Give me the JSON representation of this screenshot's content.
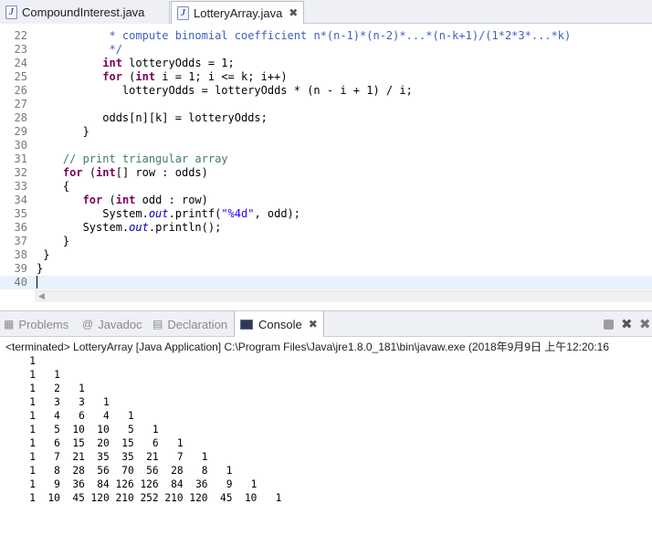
{
  "editor_tabs": [
    {
      "label": "CompoundInterest.java",
      "active": false
    },
    {
      "label": "LotteryArray.java",
      "active": true,
      "close": "✖"
    }
  ],
  "code_lines": [
    {
      "n": "22",
      "html": "           <span class=\"cm\">* compute binomial coefficient n*(n-1)*(n-2)*...*(n-k+1)/(1*2*3*...*k)</span>"
    },
    {
      "n": "23",
      "html": "           <span class=\"cm\">*/</span>"
    },
    {
      "n": "24",
      "html": "          <span class=\"kw\">int</span> lotteryOdds = 1;"
    },
    {
      "n": "25",
      "html": "          <span class=\"kw\">for</span> (<span class=\"kw\">int</span> i = 1; i &lt;= k; i++)"
    },
    {
      "n": "26",
      "html": "             lotteryOdds = lotteryOdds * (n - i + 1) / i;"
    },
    {
      "n": "27",
      "html": ""
    },
    {
      "n": "28",
      "html": "          odds[n][k] = lotteryOdds;"
    },
    {
      "n": "29",
      "html": "       }"
    },
    {
      "n": "30",
      "html": ""
    },
    {
      "n": "31",
      "html": "    <span class=\"lc\">// print triangular array</span>"
    },
    {
      "n": "32",
      "html": "    <span class=\"kw\">for</span> (<span class=\"kw\">int</span>[] row : odds)"
    },
    {
      "n": "33",
      "html": "    {"
    },
    {
      "n": "34",
      "html": "       <span class=\"kw\">for</span> (<span class=\"kw\">int</span> odd : row)"
    },
    {
      "n": "35",
      "html": "          System.<span class=\"fld\">out</span>.printf(<span class=\"str\">\"%4d\"</span>, odd);"
    },
    {
      "n": "36",
      "html": "       System.<span class=\"fld\">out</span>.println();"
    },
    {
      "n": "37",
      "html": "    }"
    },
    {
      "n": "38",
      "html": " }"
    },
    {
      "n": "39",
      "html": "}"
    },
    {
      "n": "40",
      "html": "",
      "current": true
    }
  ],
  "view_tabs": [
    {
      "label": "Problems",
      "icon": "problems-icon",
      "glyph": "▦"
    },
    {
      "label": "Javadoc",
      "icon": "javadoc-icon",
      "glyph": "@"
    },
    {
      "label": "Declaration",
      "icon": "declaration-icon",
      "glyph": "▤"
    },
    {
      "label": "Console",
      "icon": "console-icon",
      "active": true,
      "close": "✖"
    }
  ],
  "console": {
    "header": "<terminated> LotteryArray [Java Application] C:\\Program Files\\Java\\jre1.8.0_181\\bin\\javaw.exe (2018年9月9日 上午12:20:16",
    "output": [
      "   1",
      "   1   1",
      "   1   2   1",
      "   1   3   3   1",
      "   1   4   6   4   1",
      "   1   5  10  10   5   1",
      "   1   6  15  20  15   6   1",
      "   1   7  21  35  35  21   7   1",
      "   1   8  28  56  70  56  28   8   1",
      "   1   9  36  84 126 126  84  36   9   1",
      "   1  10  45 120 210 252 210 120  45  10   1"
    ]
  }
}
